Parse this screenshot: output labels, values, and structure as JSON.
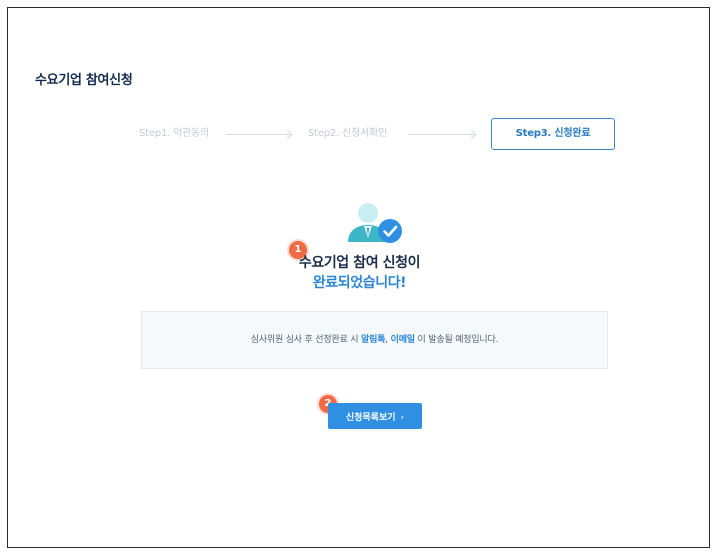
{
  "page": {
    "title": "수요기업 참여신청"
  },
  "stepper": {
    "steps": [
      {
        "label": "Step1. 약관동의",
        "state": "done"
      },
      {
        "label": "Step2. 신청서확인",
        "state": "done"
      },
      {
        "label": "Step3. 신청완료",
        "state": "active"
      }
    ]
  },
  "completion": {
    "headline_line1": "수요기업 참여 신청이",
    "headline_line2": "완료되었습니다!",
    "notice": {
      "prefix": "심사위원 심사 후 선정완료 시",
      "channel_1": "알림톡",
      "separator": ",",
      "channel_2": "이메일",
      "suffix": "이 발송될 예정입니다."
    },
    "button_label": "신청목록보기",
    "button_chevron": "›"
  },
  "markers": [
    "1",
    "2"
  ],
  "icons": {
    "illustration": "user-check-icon",
    "chevron": "chevron-right-icon"
  },
  "colors": {
    "accent": "#2f8fe3",
    "title": "#132b4f",
    "marker": "#ef6a45",
    "inactive_step": "#c3cad4"
  }
}
